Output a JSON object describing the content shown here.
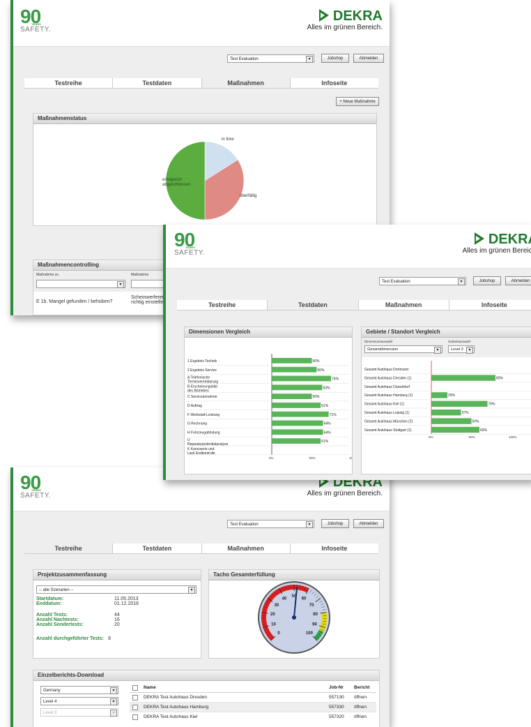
{
  "brand": {
    "ninety": "90",
    "years": "YEARS",
    "safety": "SAFETY.",
    "name": "DEKRA",
    "slogan": "Alles im grünen Bereich."
  },
  "header": {
    "evaluation_select": "Test Evaluation",
    "jobshop": "Jobshop",
    "logout": "Abmelden"
  },
  "tabs": [
    "Testreihe",
    "Testdaten",
    "Maßnahmen",
    "Infoseite"
  ],
  "win1": {
    "new_measure": "+ Neue Maßnahme",
    "status_title": "Maßnahmenstatus",
    "pie": [
      {
        "label": "in time",
        "value": 16,
        "color": "#cfe0f0"
      },
      {
        "label": "überfällig",
        "value": 34,
        "color": "#e08a86"
      },
      {
        "label": "erfolgreich abgeschlossen",
        "value": 50,
        "color": "#5aad3e"
      }
    ],
    "controlling_title": "Maßnahmencontrolling",
    "col_measure_to": "Maßnahme zu",
    "col_measure": "Maßnahme",
    "row_question": "E 1b. Mangel gefunden / behoben?",
    "row_action": "Scheinwerfereinstellung richtig einstellen"
  },
  "win2": {
    "dim_title": "Dimensionen Vergleich",
    "dims": [
      {
        "label": "1 Ergebnis Technik",
        "value": 50
      },
      {
        "label": "2 Ergebnis Service",
        "value": 56
      },
      {
        "label": "A Telefonische Terminvereinbarung",
        "value": 74
      },
      {
        "label": "B Erscheinungsbild des Betriebes",
        "value": 63
      },
      {
        "label": "C Serviceannahme",
        "value": 50
      },
      {
        "label": "D Auftrag",
        "value": 61
      },
      {
        "label": "F Werkstatt-Leistung",
        "value": 71
      },
      {
        "label": "G Rechnung",
        "value": 64
      },
      {
        "label": "H Fahrzeugabholung",
        "value": 64
      },
      {
        "label": "U Reparaturpotentialanalyse",
        "value": 61
      },
      {
        "label": "K Karosserie und Lack Endkontrolle",
        "value": null
      }
    ],
    "dim_ticks": [
      "0%",
      "50%",
      "100%"
    ],
    "region_title": "Gebiete / Standort Vergleich",
    "dim_select_label": "Dimensionsauswahl",
    "dim_select_value": "Gesamtdimension",
    "region_select_label": "Gebietsauswahl",
    "region_select_value": "Level 3",
    "regions": [
      {
        "label": "Gesamt Autohaus Dortmund",
        "value": null
      },
      {
        "label": "Gesamt Autohaus Dresden (1)",
        "value": 80
      },
      {
        "label": "Gesamt Autohaus Düsseldorf",
        "value": null
      },
      {
        "label": "Gesamt Autohaus Hamburg (1)",
        "value": 20
      },
      {
        "label": "Gesamt Autohaus Kiel (1)",
        "value": 70
      },
      {
        "label": "Gesamt Autohaus Leipzig (1)",
        "value": 37
      },
      {
        "label": "Gesamt Autohaus München (2)",
        "value": 50
      },
      {
        "label": "Gesamt Autohaus Stuttgart (1)",
        "value": 60
      }
    ],
    "region_ticks": [
      "0%",
      "50%",
      "100%"
    ]
  },
  "win3": {
    "summary_title": "Projektzusammenfassung",
    "scenario_select": "-- alle Szenarien --",
    "start_label": "Startdatum:",
    "start_value": "11.05.2013",
    "end_label": "Enddatum:",
    "end_value": "01.12.2016",
    "tests_label": "Anzahl Tests:",
    "tests_value": "44",
    "retests_label": "Anzahl Nachtests:",
    "retests_value": "16",
    "special_label": "Anzahl Sondertests:",
    "special_value": "20",
    "done_label": "Anzahl durchgeführter Tests:",
    "done_value": "8",
    "gauge_title": "Tacho Gesamterfüllung",
    "gauge_ticks": [
      "0",
      "10",
      "20",
      "30",
      "40",
      "50",
      "60",
      "70",
      "80",
      "90",
      "100"
    ],
    "gauge_value": 52,
    "download_title": "Einzelberichts-Download",
    "filter_country": "Germany",
    "filter_level4": "Level 4",
    "filter_level3": "Level 3",
    "col_name": "Name",
    "col_job": "Job-Nr",
    "col_report": "Bericht",
    "rows": [
      {
        "name": "DEKRA Test Autohaus Dresden",
        "job": "557130",
        "report": "öffnen"
      },
      {
        "name": "DEKRA Test Autohaus Hamburg",
        "job": "557330",
        "report": "öffnen"
      },
      {
        "name": "DEKRA Test Autohaus Kiel",
        "job": "557320",
        "report": "öffnen"
      }
    ]
  }
}
